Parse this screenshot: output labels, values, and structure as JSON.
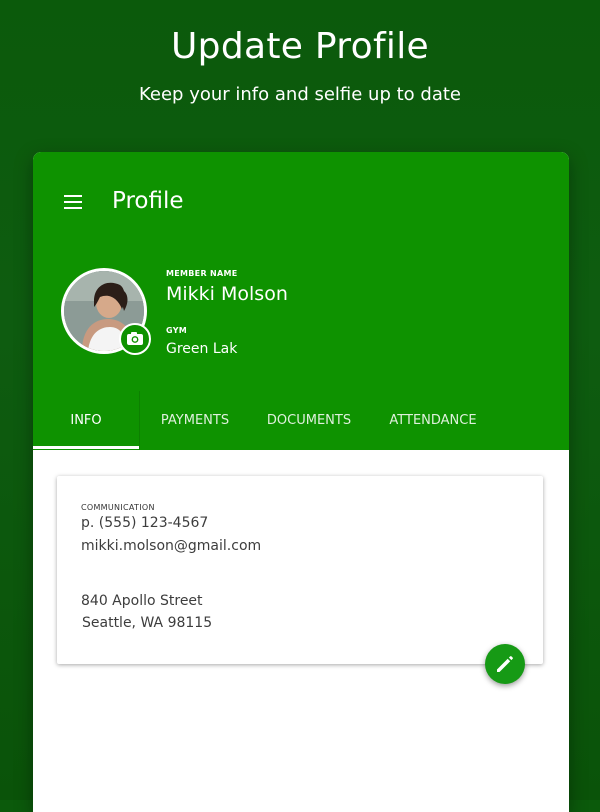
{
  "promo": {
    "title": "Update Profile",
    "subtitle": "Keep your info and selfie up to date"
  },
  "header": {
    "title": "Profile",
    "menu_icon": "hamburger-menu-icon"
  },
  "member": {
    "name_label": "MEMBER NAME",
    "name": "Mikki Molson",
    "gym_label": "GYM",
    "gym": "Green Lak",
    "avatar_icon": "avatar-photo",
    "camera_icon": "camera-icon"
  },
  "tabs": [
    {
      "label": "INFO",
      "active": true
    },
    {
      "label": "PAYMENTS",
      "active": false
    },
    {
      "label": "DOCUMENTS",
      "active": false
    },
    {
      "label": "ATTENDANCE",
      "active": false
    }
  ],
  "info": {
    "communication_label": "COMMUNICATION",
    "phone": "p. (555) 123-4567",
    "email": "mikki.molson@gmail.com",
    "address_line1": "840 Apollo Street",
    "address_line2": "Seattle, WA 98115"
  },
  "fab": {
    "icon": "pencil-edit-icon"
  },
  "colors": {
    "brand_green": "#0e9200",
    "background_dark_green": "#0b5a0b",
    "card_white": "#ffffff"
  }
}
